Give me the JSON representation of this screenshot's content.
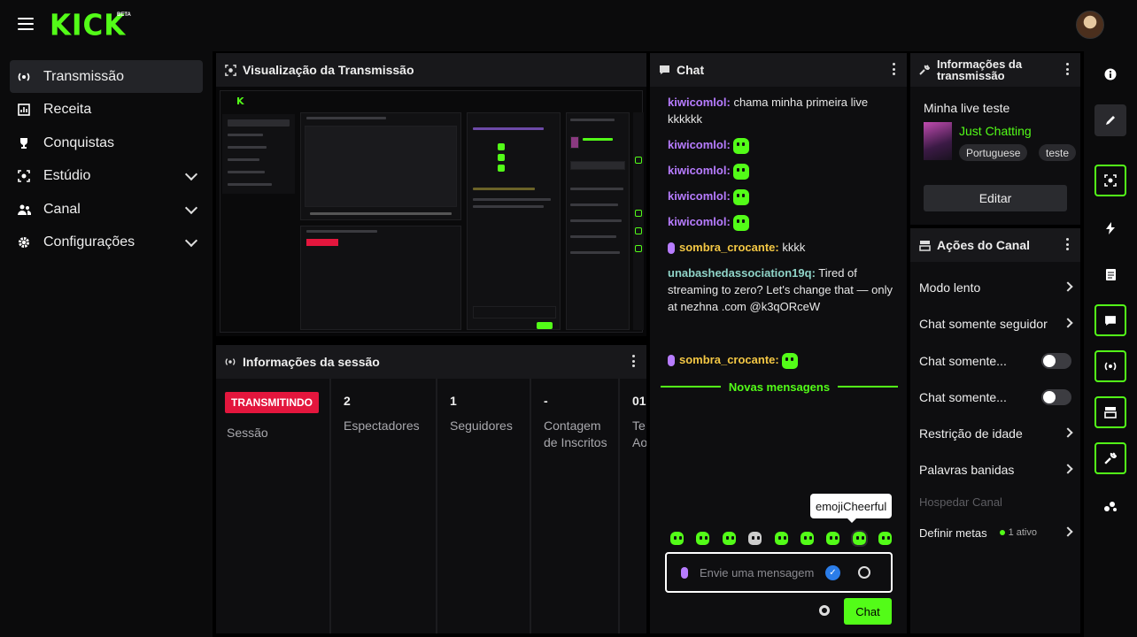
{
  "brand": {
    "logo": "KICK",
    "beta": "BETA",
    "accent": "#53fc18"
  },
  "sidebar": {
    "items": [
      {
        "label": "Transmissão",
        "icon": "broadcast-icon",
        "active": true
      },
      {
        "label": "Receita",
        "icon": "chart-icon"
      },
      {
        "label": "Conquistas",
        "icon": "trophy-icon"
      },
      {
        "label": "Estúdio",
        "icon": "studio-icon",
        "expandable": true
      },
      {
        "label": "Canal",
        "icon": "users-icon",
        "expandable": true
      },
      {
        "label": "Configurações",
        "icon": "gear-icon",
        "expandable": true
      }
    ]
  },
  "preview": {
    "title": "Visualização da Transmissão"
  },
  "session": {
    "title": "Informações da sessão",
    "status_badge": "TRANSMITINDO",
    "status_label": "Sessão",
    "viewers_value": "2",
    "viewers_label": "Espectadores",
    "followers_value": "1",
    "followers_label": "Seguidores",
    "subs_value": "-",
    "subs_label": "Contagem de Inscritos",
    "cut_value": "01",
    "cut_label": "Te Ao"
  },
  "chat": {
    "title": "Chat",
    "messages": [
      {
        "user": "kiwicomlol",
        "text": "chama minha primeira live kkkkkk"
      },
      {
        "user": "kiwicomlol"
      },
      {
        "user": "kiwicomlol"
      },
      {
        "user": "kiwicomlol"
      },
      {
        "user": "kiwicomlol"
      },
      {
        "user": "sombra_crocante",
        "text": "kkkk"
      },
      {
        "user": "unabashedassociation19q",
        "text": "Tired of streaming to zero? Let's change that — only at nezhna .com @k3qORceW"
      },
      {
        "user": "sombra_crocante"
      }
    ],
    "new_messages_label": "Novas mensagens",
    "tooltip": "emojiCheerful",
    "input_placeholder": "Envie uma mensagem",
    "send_label": "Chat"
  },
  "stream_info": {
    "title": "Informações da transmissão",
    "stream_title": "Minha live teste",
    "category": "Just Chatting",
    "tags": [
      "Portuguese",
      "teste"
    ],
    "edit_label": "Editar"
  },
  "actions": {
    "title": "Ações do Canal",
    "rows": [
      {
        "label": "Modo lento"
      },
      {
        "label": "Chat somente seguidor"
      },
      {
        "label": "Chat somente..."
      },
      {
        "label": "Chat somente..."
      },
      {
        "label": "Restrição de idade"
      },
      {
        "label": "Palavras banidas"
      },
      {
        "label": "Hospedar Canal"
      },
      {
        "label": "Definir metas",
        "status": "1 ativo"
      }
    ]
  },
  "rail": {
    "icons": [
      "info-icon",
      "pencil-icon",
      "camera-icon",
      "lightning-icon",
      "notes-icon",
      "chat-icon",
      "broadcast-icon",
      "layout-icon",
      "wrench-icon",
      "apps-icon"
    ]
  }
}
